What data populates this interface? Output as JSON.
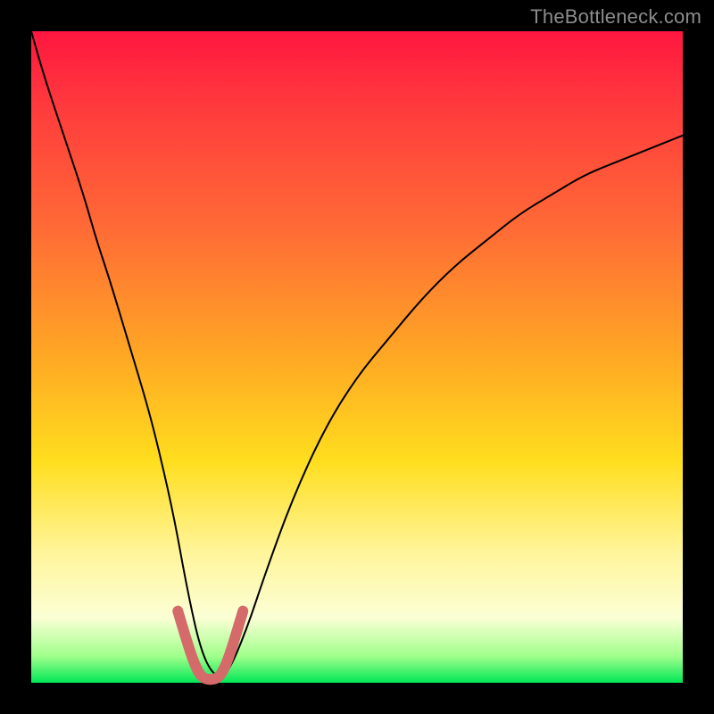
{
  "watermark": "TheBottleneck.com",
  "chart_data": {
    "type": "line",
    "title": "",
    "xlabel": "",
    "ylabel": "",
    "xlim": [
      0,
      100
    ],
    "ylim": [
      0,
      100
    ],
    "grid": false,
    "legend": false,
    "series": [
      {
        "name": "bottleneck-curve",
        "color": "#000000",
        "stroke_width": 2,
        "x": [
          0,
          2,
          5,
          8,
          10,
          12,
          15,
          18,
          20,
          22,
          24,
          26,
          28,
          30,
          33,
          36,
          40,
          45,
          50,
          55,
          60,
          65,
          70,
          75,
          80,
          85,
          90,
          95,
          100
        ],
        "y": [
          100,
          93,
          84,
          75,
          68,
          62,
          52,
          42,
          34,
          25,
          14,
          5,
          1,
          1,
          8,
          17,
          28,
          39,
          47,
          53,
          59,
          64,
          68,
          72,
          75,
          78,
          80,
          82,
          84
        ]
      },
      {
        "name": "highlight-segment",
        "color": "#d46a6a",
        "stroke_width": 12,
        "x": [
          22.5,
          24,
          25,
          26,
          27,
          28,
          29,
          30,
          31,
          32.5
        ],
        "y": [
          11,
          6,
          3,
          1,
          0.5,
          0.5,
          1,
          3,
          6,
          11
        ]
      }
    ],
    "gradient_stops": [
      {
        "pos": 0.0,
        "color": "#ff163f"
      },
      {
        "pos": 0.12,
        "color": "#ff3c3d"
      },
      {
        "pos": 0.3,
        "color": "#ff6a36"
      },
      {
        "pos": 0.5,
        "color": "#ffa824"
      },
      {
        "pos": 0.66,
        "color": "#ffde1e"
      },
      {
        "pos": 0.8,
        "color": "#fff59a"
      },
      {
        "pos": 0.9,
        "color": "#fbffd5"
      },
      {
        "pos": 0.96,
        "color": "#9eff8a"
      },
      {
        "pos": 1.0,
        "color": "#00e756"
      }
    ]
  },
  "plot_geometry": {
    "inner_left": 35,
    "inner_top": 35,
    "inner_width": 730,
    "inner_height": 730
  }
}
